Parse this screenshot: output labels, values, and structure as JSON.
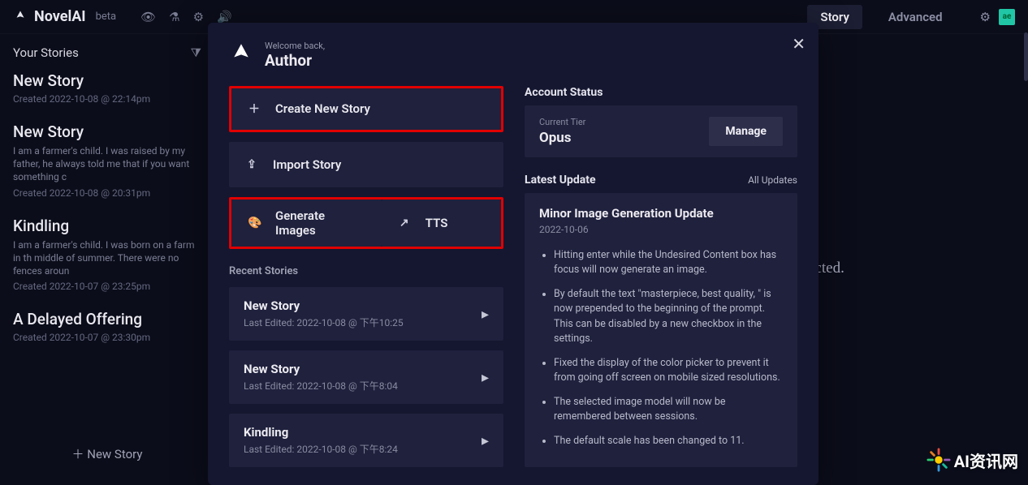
{
  "brand": {
    "name": "NovelAI",
    "tag": "beta"
  },
  "tabs": {
    "story": "Story",
    "advanced": "Advanced"
  },
  "avatar": "ae",
  "sidebar": {
    "title": "Your Stories",
    "items": [
      {
        "title": "New Story",
        "snippet": "",
        "meta": "Created 2022-10-08 @ 22:14pm"
      },
      {
        "title": "New Story",
        "snippet": "I am a farmer's child. I was raised by my father, he always told me that if you want something c",
        "meta": "Created 2022-10-08 @ 20:31pm"
      },
      {
        "title": "Kindling",
        "snippet": "I am a farmer's child. I was born on a farm in th middle of summer. There were no fences aroun",
        "meta": "Created 2022-10-07 @ 23:25pm"
      },
      {
        "title": "A Delayed Offering",
        "snippet": "",
        "meta": "Created 2022-10-07 @ 23:30pm"
      }
    ],
    "new_story": "New Story"
  },
  "main_placeholder": "No Story selected.",
  "modal": {
    "welcome": "Welcome back,",
    "author": "Author",
    "actions": {
      "create": "Create New Story",
      "import": "Import Story",
      "gen": "Generate Images",
      "tts": "TTS"
    },
    "recent_heading": "Recent Stories",
    "recent": [
      {
        "name": "New Story",
        "edited": "Last Edited: 2022-10-08 @ 下午10:25"
      },
      {
        "name": "New Story",
        "edited": "Last Edited: 2022-10-08 @ 下午8:04"
      },
      {
        "name": "Kindling",
        "edited": "Last Edited: 2022-10-08 @ 下午8:24"
      }
    ],
    "account": {
      "heading": "Account Status",
      "tier_label": "Current Tier",
      "tier_value": "Opus",
      "manage": "Manage"
    },
    "updates": {
      "heading": "Latest Update",
      "all": "All Updates",
      "title": "Minor Image Generation Update",
      "date": "2022-10-06",
      "items": [
        "Hitting enter while the Undesired Content box has focus will now generate an image.",
        "By default the text \"masterpiece, best quality, \" is now prepended to the beginning of the prompt. This can be disabled by a new checkbox in the settings.",
        "Fixed the display of the color picker to prevent it from going off screen on mobile sized resolutions.",
        "The selected image model will now be remembered between sessions.",
        "The default scale has been changed to 11."
      ]
    }
  },
  "watermark": "AI资讯网"
}
